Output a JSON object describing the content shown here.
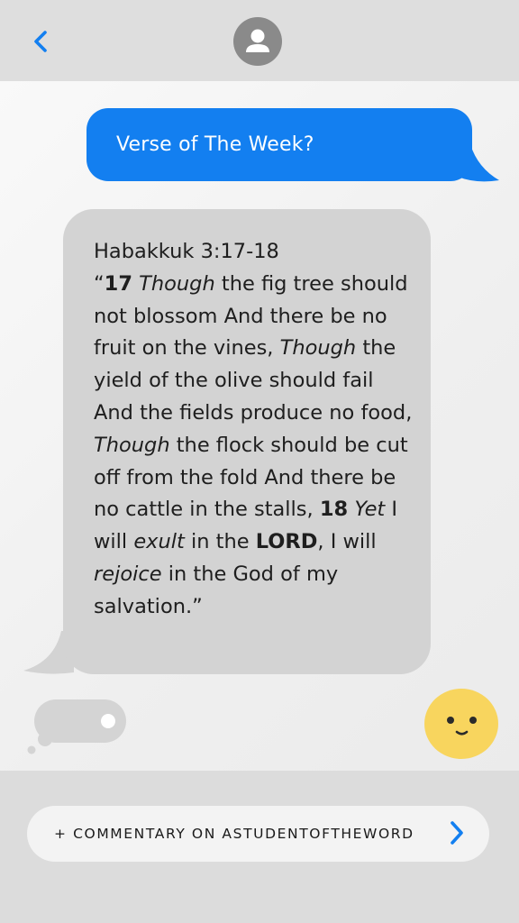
{
  "header": {
    "back_icon": "chevron-left-icon",
    "avatar_icon": "person-icon",
    "accent_color": "#137ff0"
  },
  "messages": {
    "outgoing": {
      "text": "Verse of The Week?"
    },
    "incoming": {
      "reference": "Habakkuk 3:17-18",
      "verse_parts": [
        {
          "text": "“",
          "style": "normal"
        },
        {
          "text": "17",
          "style": "bold"
        },
        {
          "text": " ",
          "style": "normal"
        },
        {
          "text": "Though",
          "style": "italic"
        },
        {
          "text": " the fig tree should not blossom And there be no fruit on the vines, ",
          "style": "normal"
        },
        {
          "text": "Though",
          "style": "italic"
        },
        {
          "text": " the yield of the olive should fail And the fields produce no food, ",
          "style": "normal"
        },
        {
          "text": "Though",
          "style": "italic"
        },
        {
          "text": " the flock should be cut off from the fold And there be no cattle in the stalls, ",
          "style": "normal"
        },
        {
          "text": "18",
          "style": "bold"
        },
        {
          "text": " ",
          "style": "normal"
        },
        {
          "text": "Yet",
          "style": "italic"
        },
        {
          "text": " I will ",
          "style": "normal"
        },
        {
          "text": "exult",
          "style": "italic"
        },
        {
          "text": " in the ",
          "style": "normal"
        },
        {
          "text": "LORD",
          "style": "bold"
        },
        {
          "text": ", I will ",
          "style": "normal"
        },
        {
          "text": "rejoice",
          "style": "italic"
        },
        {
          "text": " in the God of my salvation.”",
          "style": "normal"
        }
      ]
    }
  },
  "indicators": {
    "typing_icon": "thought-bubble-icon",
    "emoji_icon": "smiley-face-icon"
  },
  "footer": {
    "link_label": "+ COMMENTARY ON ASTUDENTOFTHEWORD",
    "arrow_icon": "chevron-right-icon"
  }
}
